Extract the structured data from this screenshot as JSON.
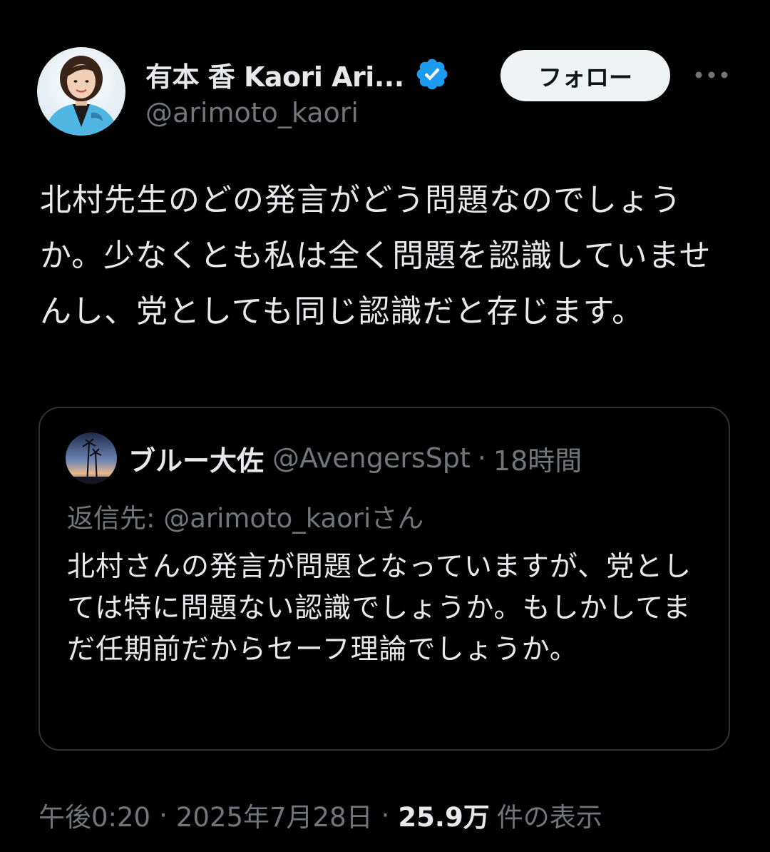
{
  "author": {
    "display_name": "有本 香 Kaori Ari...",
    "handle": "@arimoto_kaori",
    "avatar_icon": "profile-photo",
    "verified_icon": "verified-badge-icon",
    "verified_color": "#1d9bf0"
  },
  "actions": {
    "follow_label": "フォロー",
    "more_icon": "more-dots-icon"
  },
  "tweet": {
    "text": "北村先生のどの発言がどう問題なのでしょうか。少なくとも私は全く問題を認識していませんし、党としても同じ認識だと存じます。"
  },
  "quote": {
    "avatar_icon": "palm-tree-sunset-avatar",
    "name": "ブルー大佐",
    "handle": "@AvengersSpt",
    "dot": "·",
    "time": "18時間",
    "reply_to": "返信先: @arimoto_kaoriさん",
    "text": "北村さんの発言が問題となっていますが、党としては特に問題ない認識でしょうか。もしかしてまだ任期前だからセーフ理論でしょうか。"
  },
  "footer": {
    "time": "午後0:20",
    "dot1": "·",
    "date": "2025年7月28日",
    "dot2": "·",
    "views_count": "25.9万",
    "views_label": "件の表示"
  },
  "colors": {
    "background": "#000000",
    "primary_text": "#e7e9ea",
    "secondary_text": "#71767b",
    "border": "#2f3336",
    "follow_bg": "#eff3f4"
  }
}
